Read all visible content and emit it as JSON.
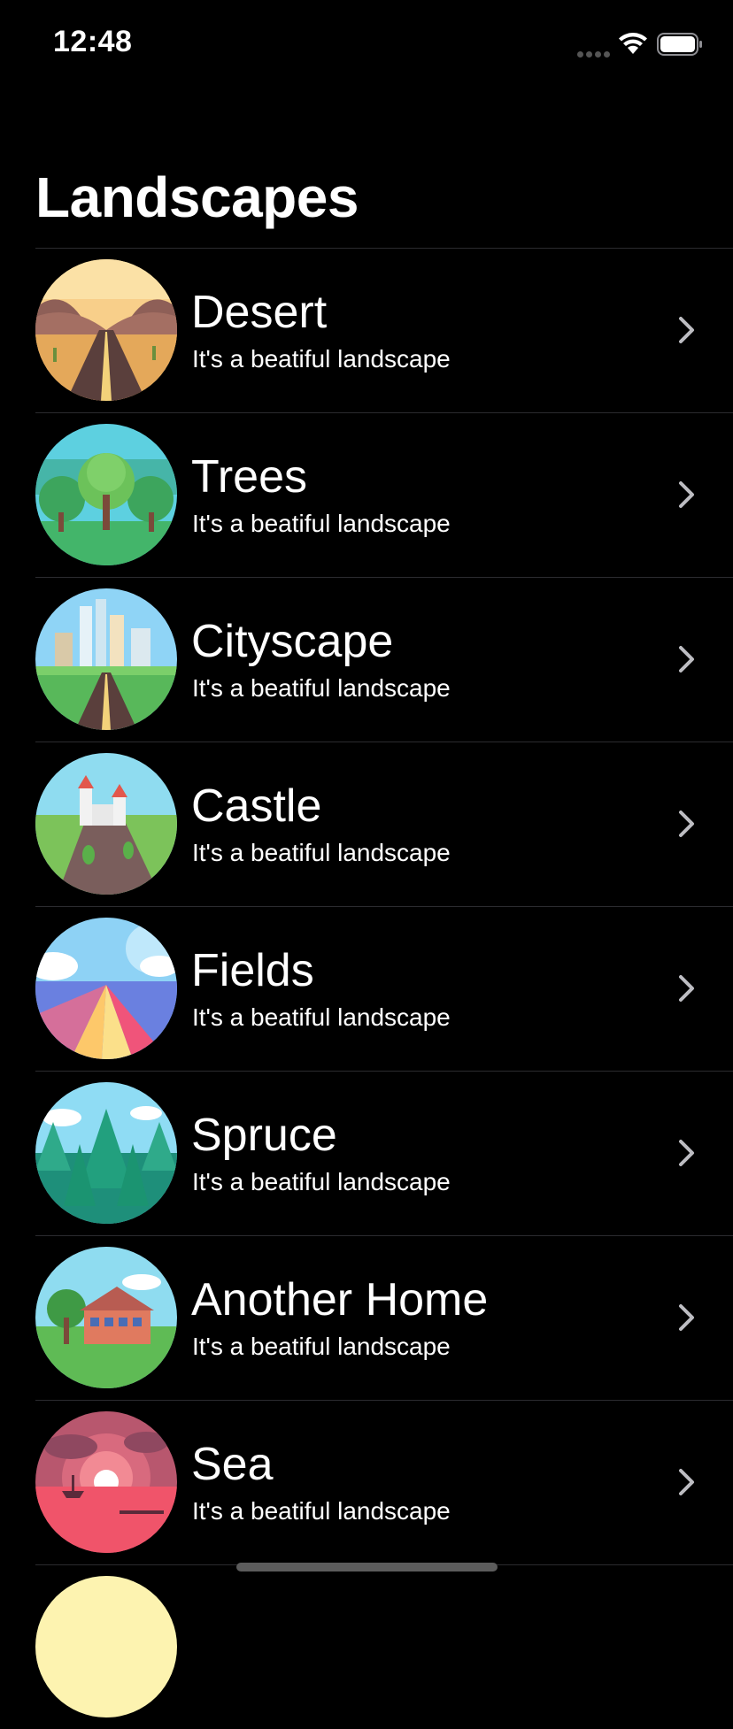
{
  "status_bar": {
    "time": "12:48",
    "icons": [
      "cellular-signal-icon",
      "wifi-icon",
      "battery-icon"
    ]
  },
  "header": {
    "title": "Landscapes"
  },
  "landscapes": [
    {
      "name": "Desert",
      "subtitle": "It's a beatiful landscape",
      "icon": "desert-road"
    },
    {
      "name": "Trees",
      "subtitle": "It's a beatiful landscape",
      "icon": "forest-trees"
    },
    {
      "name": "Cityscape",
      "subtitle": "It's a beatiful landscape",
      "icon": "city-road"
    },
    {
      "name": "Castle",
      "subtitle": "It's a beatiful landscape",
      "icon": "castle-on-rock"
    },
    {
      "name": "Fields",
      "subtitle": "It's a beatiful landscape",
      "icon": "flower-fields"
    },
    {
      "name": "Spruce",
      "subtitle": "It's a beatiful landscape",
      "icon": "spruce-forest"
    },
    {
      "name": "Another Home",
      "subtitle": "It's a beatiful landscape",
      "icon": "house"
    },
    {
      "name": "Sea",
      "subtitle": "It's a beatiful landscape",
      "icon": "sea-sunset"
    }
  ],
  "colors": {
    "background": "#000000",
    "separator": "#2b2b2f",
    "chevron": "#bdbdc2",
    "text": "#ffffff"
  }
}
